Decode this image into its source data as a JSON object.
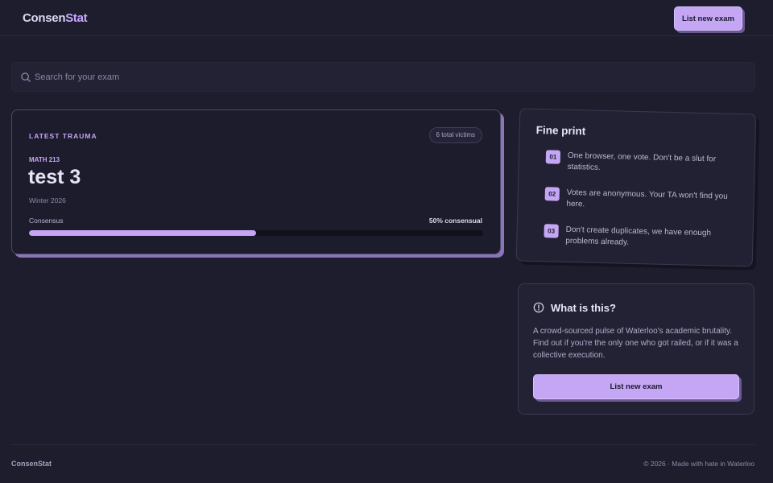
{
  "header": {
    "logo_main": "Consen",
    "logo_accent": "Stat",
    "list_button_label": "List new exam"
  },
  "search": {
    "placeholder": "Search for your exam"
  },
  "exam_card": {
    "eyebrow": "LATEST TRAUMA",
    "victims": "6 total victims",
    "course": "MATH 213",
    "title": "test 3",
    "term": "Winter 2026",
    "consensus_label": "Consensus",
    "consensus_pct_label": "50% consensual",
    "consensus_fraction": 0.5
  },
  "fine_print": {
    "title": "Fine print",
    "items": [
      {
        "num": "01",
        "text": "One browser, one vote. Don't be a slut for statistics."
      },
      {
        "num": "02",
        "text": "Votes are anonymous. Your TA won't find you here."
      },
      {
        "num": "03",
        "text": "Don't create duplicates, we have enough problems already."
      }
    ]
  },
  "what_is_this": {
    "title": "What is this?",
    "description": "A crowd-sourced pulse of Waterloo's academic brutality. Find out if you're the only one who got railed, or if it was a collective execution.",
    "button_label": "List new exam"
  },
  "footer": {
    "logo": "ConsenStat",
    "copyright": "© 2026 · Made with hate in Waterloo"
  },
  "colors": {
    "background": "#1e1d2e",
    "accent": "#c4a6f5",
    "card_shadow": "#8b74b8"
  },
  "icons": {
    "search": "search-icon",
    "info": "info-circle-icon"
  }
}
